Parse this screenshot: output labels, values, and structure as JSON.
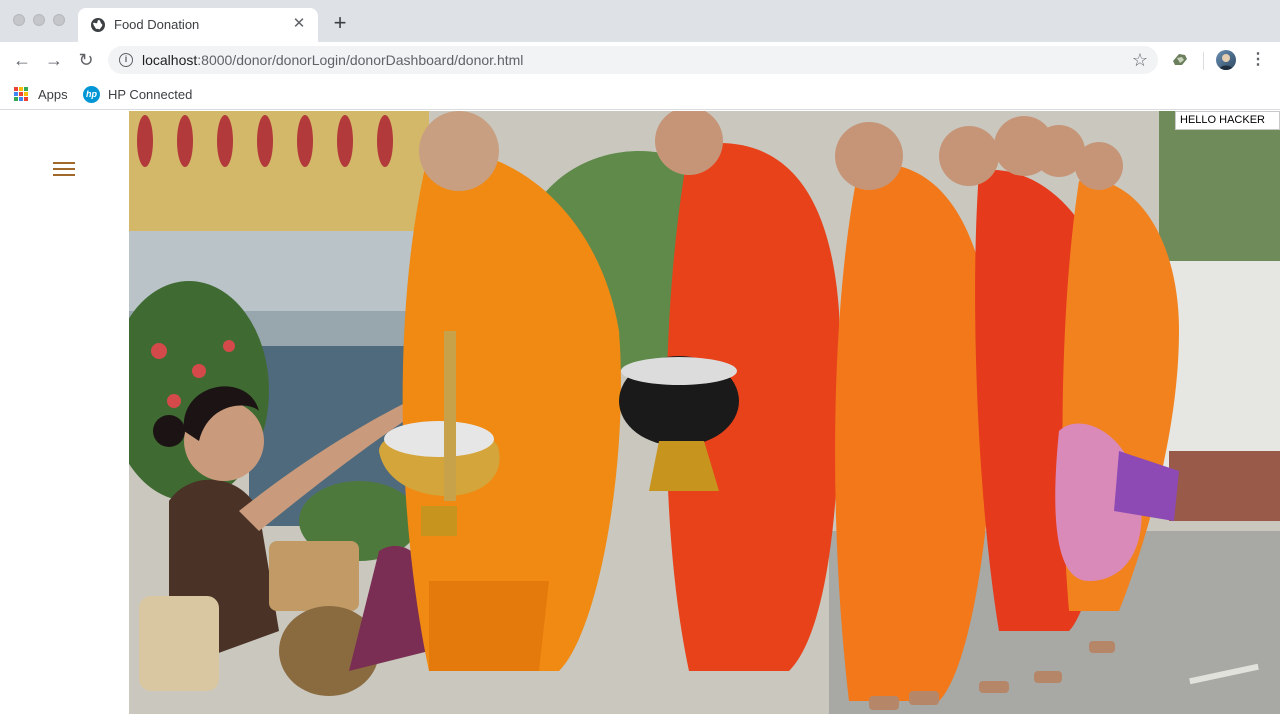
{
  "browser": {
    "tab": {
      "title": "Food Donation",
      "favicon": "globe-icon"
    },
    "address_bar": {
      "host": "localhost",
      "path": ":8000/donor/donorLogin/donorDashboard/donor.html"
    },
    "bookmarks": [
      {
        "label": "Apps",
        "icon": "apps-grid-icon"
      },
      {
        "label": "HP Connected",
        "icon": "hp-logo-icon"
      }
    ]
  },
  "page": {
    "menu_icon": "hamburger-menu-icon",
    "greeting": "HELLO HACKER",
    "hero_image": "photo: monks in orange robes receiving alms from a kneeling woman",
    "colors": {
      "accent": "#a0692a"
    }
  }
}
